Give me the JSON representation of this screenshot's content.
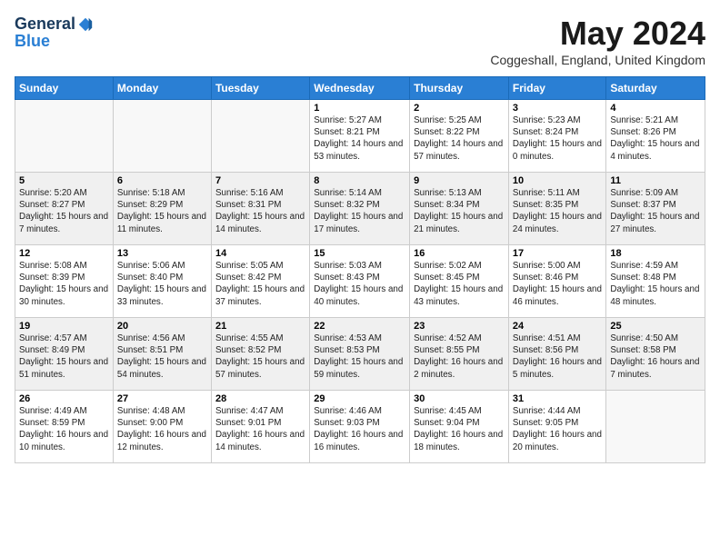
{
  "logo": {
    "general": "General",
    "blue": "Blue"
  },
  "header": {
    "title": "May 2024",
    "location": "Coggeshall, England, United Kingdom"
  },
  "weekdays": [
    "Sunday",
    "Monday",
    "Tuesday",
    "Wednesday",
    "Thursday",
    "Friday",
    "Saturday"
  ],
  "weeks": [
    [
      {
        "day": "",
        "info": ""
      },
      {
        "day": "",
        "info": ""
      },
      {
        "day": "",
        "info": ""
      },
      {
        "day": "1",
        "info": "Sunrise: 5:27 AM\nSunset: 8:21 PM\nDaylight: 14 hours and 53 minutes."
      },
      {
        "day": "2",
        "info": "Sunrise: 5:25 AM\nSunset: 8:22 PM\nDaylight: 14 hours and 57 minutes."
      },
      {
        "day": "3",
        "info": "Sunrise: 5:23 AM\nSunset: 8:24 PM\nDaylight: 15 hours and 0 minutes."
      },
      {
        "day": "4",
        "info": "Sunrise: 5:21 AM\nSunset: 8:26 PM\nDaylight: 15 hours and 4 minutes."
      }
    ],
    [
      {
        "day": "5",
        "info": "Sunrise: 5:20 AM\nSunset: 8:27 PM\nDaylight: 15 hours and 7 minutes."
      },
      {
        "day": "6",
        "info": "Sunrise: 5:18 AM\nSunset: 8:29 PM\nDaylight: 15 hours and 11 minutes."
      },
      {
        "day": "7",
        "info": "Sunrise: 5:16 AM\nSunset: 8:31 PM\nDaylight: 15 hours and 14 minutes."
      },
      {
        "day": "8",
        "info": "Sunrise: 5:14 AM\nSunset: 8:32 PM\nDaylight: 15 hours and 17 minutes."
      },
      {
        "day": "9",
        "info": "Sunrise: 5:13 AM\nSunset: 8:34 PM\nDaylight: 15 hours and 21 minutes."
      },
      {
        "day": "10",
        "info": "Sunrise: 5:11 AM\nSunset: 8:35 PM\nDaylight: 15 hours and 24 minutes."
      },
      {
        "day": "11",
        "info": "Sunrise: 5:09 AM\nSunset: 8:37 PM\nDaylight: 15 hours and 27 minutes."
      }
    ],
    [
      {
        "day": "12",
        "info": "Sunrise: 5:08 AM\nSunset: 8:39 PM\nDaylight: 15 hours and 30 minutes."
      },
      {
        "day": "13",
        "info": "Sunrise: 5:06 AM\nSunset: 8:40 PM\nDaylight: 15 hours and 33 minutes."
      },
      {
        "day": "14",
        "info": "Sunrise: 5:05 AM\nSunset: 8:42 PM\nDaylight: 15 hours and 37 minutes."
      },
      {
        "day": "15",
        "info": "Sunrise: 5:03 AM\nSunset: 8:43 PM\nDaylight: 15 hours and 40 minutes."
      },
      {
        "day": "16",
        "info": "Sunrise: 5:02 AM\nSunset: 8:45 PM\nDaylight: 15 hours and 43 minutes."
      },
      {
        "day": "17",
        "info": "Sunrise: 5:00 AM\nSunset: 8:46 PM\nDaylight: 15 hours and 46 minutes."
      },
      {
        "day": "18",
        "info": "Sunrise: 4:59 AM\nSunset: 8:48 PM\nDaylight: 15 hours and 48 minutes."
      }
    ],
    [
      {
        "day": "19",
        "info": "Sunrise: 4:57 AM\nSunset: 8:49 PM\nDaylight: 15 hours and 51 minutes."
      },
      {
        "day": "20",
        "info": "Sunrise: 4:56 AM\nSunset: 8:51 PM\nDaylight: 15 hours and 54 minutes."
      },
      {
        "day": "21",
        "info": "Sunrise: 4:55 AM\nSunset: 8:52 PM\nDaylight: 15 hours and 57 minutes."
      },
      {
        "day": "22",
        "info": "Sunrise: 4:53 AM\nSunset: 8:53 PM\nDaylight: 15 hours and 59 minutes."
      },
      {
        "day": "23",
        "info": "Sunrise: 4:52 AM\nSunset: 8:55 PM\nDaylight: 16 hours and 2 minutes."
      },
      {
        "day": "24",
        "info": "Sunrise: 4:51 AM\nSunset: 8:56 PM\nDaylight: 16 hours and 5 minutes."
      },
      {
        "day": "25",
        "info": "Sunrise: 4:50 AM\nSunset: 8:58 PM\nDaylight: 16 hours and 7 minutes."
      }
    ],
    [
      {
        "day": "26",
        "info": "Sunrise: 4:49 AM\nSunset: 8:59 PM\nDaylight: 16 hours and 10 minutes."
      },
      {
        "day": "27",
        "info": "Sunrise: 4:48 AM\nSunset: 9:00 PM\nDaylight: 16 hours and 12 minutes."
      },
      {
        "day": "28",
        "info": "Sunrise: 4:47 AM\nSunset: 9:01 PM\nDaylight: 16 hours and 14 minutes."
      },
      {
        "day": "29",
        "info": "Sunrise: 4:46 AM\nSunset: 9:03 PM\nDaylight: 16 hours and 16 minutes."
      },
      {
        "day": "30",
        "info": "Sunrise: 4:45 AM\nSunset: 9:04 PM\nDaylight: 16 hours and 18 minutes."
      },
      {
        "day": "31",
        "info": "Sunrise: 4:44 AM\nSunset: 9:05 PM\nDaylight: 16 hours and 20 minutes."
      },
      {
        "day": "",
        "info": ""
      }
    ]
  ]
}
